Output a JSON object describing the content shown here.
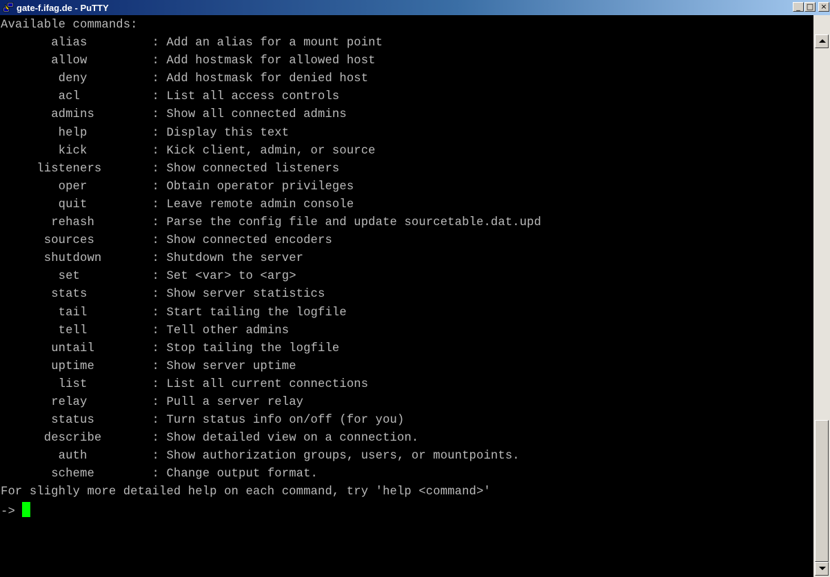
{
  "window": {
    "title": "gate-f.ifag.de - PuTTY",
    "icon": "putty-icon",
    "controls": {
      "minimize": "_",
      "maximize": "□",
      "close": "×"
    }
  },
  "terminal": {
    "header": "Available commands:",
    "commands": [
      {
        "name": "alias",
        "desc": "Add an alias for a mount point"
      },
      {
        "name": "allow",
        "desc": "Add hostmask for allowed host"
      },
      {
        "name": "deny",
        "desc": "Add hostmask for denied host"
      },
      {
        "name": "acl",
        "desc": "List all access controls"
      },
      {
        "name": "admins",
        "desc": "Show all connected admins"
      },
      {
        "name": "help",
        "desc": "Display this text"
      },
      {
        "name": "kick",
        "desc": "Kick client, admin, or source"
      },
      {
        "name": "listeners",
        "desc": "Show connected listeners"
      },
      {
        "name": "oper",
        "desc": "Obtain operator privileges"
      },
      {
        "name": "quit",
        "desc": "Leave remote admin console"
      },
      {
        "name": "rehash",
        "desc": "Parse the config file and update sourcetable.dat.upd"
      },
      {
        "name": "sources",
        "desc": "Show connected encoders"
      },
      {
        "name": "shutdown",
        "desc": "Shutdown the server"
      },
      {
        "name": "set",
        "desc": "Set <var> to <arg>"
      },
      {
        "name": "stats",
        "desc": "Show server statistics"
      },
      {
        "name": "tail",
        "desc": "Start tailing the logfile"
      },
      {
        "name": "tell",
        "desc": "Tell other admins"
      },
      {
        "name": "untail",
        "desc": "Stop tailing the logfile"
      },
      {
        "name": "uptime",
        "desc": "Show server uptime"
      },
      {
        "name": "list",
        "desc": "List all current connections"
      },
      {
        "name": "relay",
        "desc": "Pull a server relay"
      },
      {
        "name": "status",
        "desc": "Turn status info on/off (for you)"
      },
      {
        "name": "describe",
        "desc": "Show detailed view on a connection."
      },
      {
        "name": "auth",
        "desc": "Show authorization groups, users, or mountpoints."
      },
      {
        "name": "scheme",
        "desc": "Change output format."
      }
    ],
    "footer": "For slighly more detailed help on each command, try 'help <command>'",
    "prompt": "-> "
  },
  "colors": {
    "text": "#bbbbbb",
    "background": "#000000",
    "cursor": "#00ff00",
    "titlebar": "#0a246a"
  }
}
